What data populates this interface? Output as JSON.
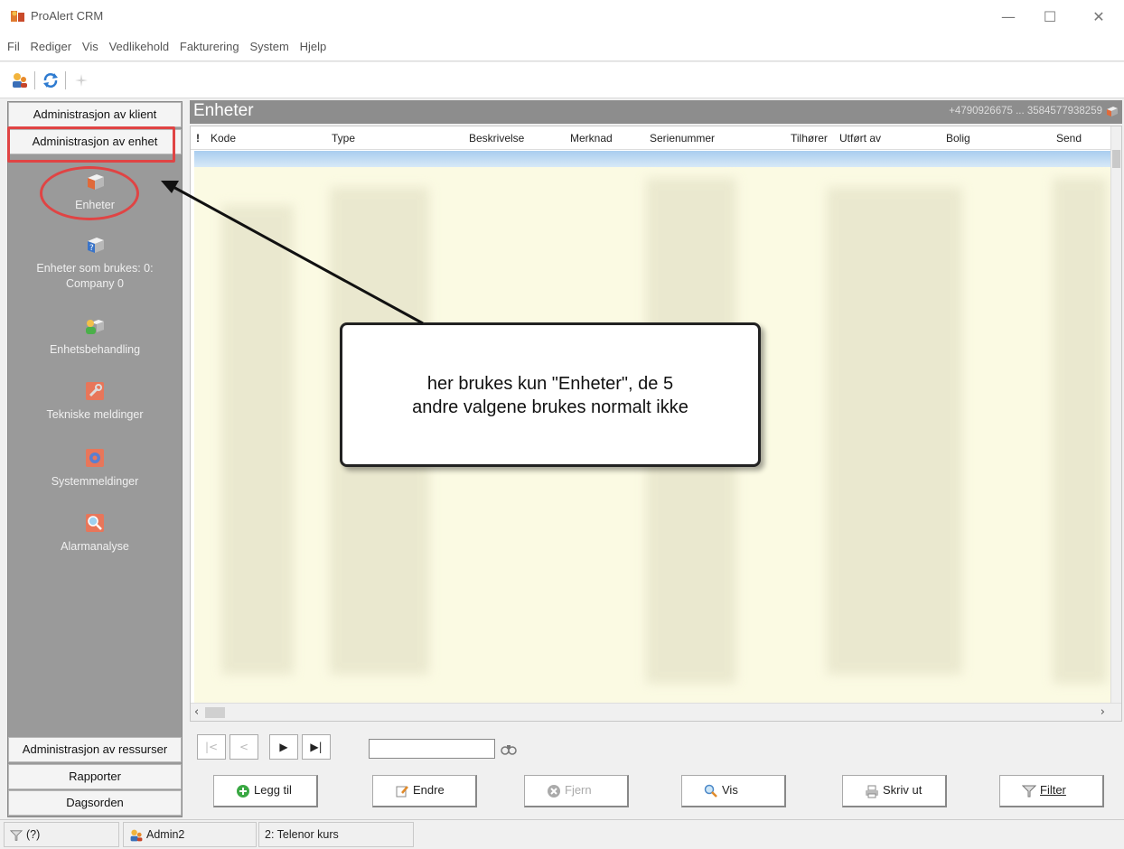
{
  "window": {
    "title": "ProAlert CRM",
    "minimize_glyph": "—",
    "maximize_glyph": "☐",
    "close_glyph": "✕"
  },
  "menu": {
    "items": [
      "Fil",
      "Rediger",
      "Vis",
      "Vedlikehold",
      "Fakturering",
      "System",
      "Hjelp"
    ]
  },
  "toolbar": {
    "icons": [
      "user-group-icon",
      "refresh-icon",
      "disabled-sparkle-icon"
    ]
  },
  "nav": {
    "headers_top": [
      "Administrasjon av klient",
      "Administrasjon av enhet"
    ],
    "items": [
      {
        "label": "Enheter",
        "icon": "device-box-icon"
      },
      {
        "label": "Enheter som brukes: 0: Company 0",
        "icon": "device-question-icon"
      },
      {
        "label": "Enhetsbehandling",
        "icon": "device-user-icon"
      },
      {
        "label": "Tekniske meldinger",
        "icon": "wrench-icon"
      },
      {
        "label": "Systemmeldinger",
        "icon": "gear-icon"
      },
      {
        "label": "Alarmanalyse",
        "icon": "magnifier-icon"
      }
    ],
    "headers_bottom": [
      "Administrasjon av ressurser",
      "Rapporter",
      "Dagsorden"
    ]
  },
  "content": {
    "title": "Enheter",
    "phones": "+4790926675 ... 3584577938259",
    "columns": [
      "!",
      "Kode",
      "Type",
      "Beskrivelse",
      "Merknad",
      "Serienummer",
      "Tilhører",
      "Utført av",
      "Bolig",
      "Send"
    ]
  },
  "callout": {
    "line1": "her brukes kun \"Enheter\", de 5",
    "line2": "andre valgene brukes normalt ikke"
  },
  "recnav": {
    "first": "|<",
    "prev": "<",
    "next": "▶",
    "last": "▶|",
    "search_value": ""
  },
  "actions": {
    "add": "Legg til",
    "edit": "Endre",
    "remove": "Fjern",
    "view": "Vis",
    "print": "Skriv ut",
    "filter": "Filter"
  },
  "status": {
    "filter": "(?)",
    "user": "Admin2",
    "course": "2: Telenor kurs"
  },
  "colors": {
    "nav_bg": "#9a9a9a",
    "header_bg": "#8d8d8d",
    "table_bg": "#fbfae3",
    "highlight": "#e04444"
  }
}
